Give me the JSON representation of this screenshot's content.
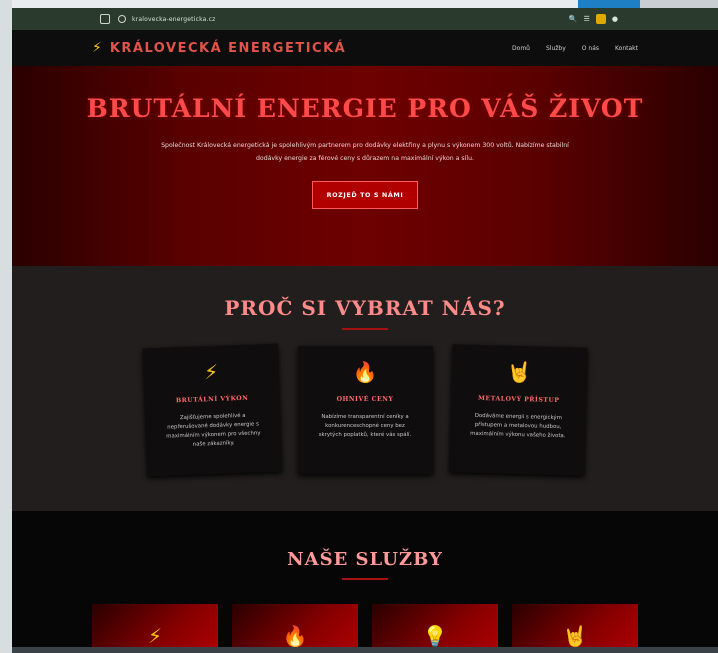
{
  "browser": {
    "url": "kralovecka-energeticka.cz",
    "right_icons": [
      "zoom-icon",
      "menu-icon",
      "extension-icon",
      "profile-icon"
    ]
  },
  "nav": {
    "logo_icon": "lightning-icon",
    "logo_text": "KRÁLOVECKÁ ENERGETICKÁ",
    "links": [
      "Domů",
      "Služby",
      "O nás",
      "Kontakt"
    ]
  },
  "hero": {
    "title": "BRUTÁLNÍ ENERGIE PRO VÁŠ ŽIVOT",
    "text": "Společnost Královecká energetická je spolehlivým partnerem pro dodávky elektřiny a plynu s výkonem 300 voltů. Nabízíme stabilní dodávky energie za férové ceny s důrazem na maximální výkon a sílu.",
    "button": "ROZJEĎ TO S NÁMI"
  },
  "why": {
    "title": "PROČ SI VYBRAT NÁS?",
    "cards": [
      {
        "icon": "lightning-icon",
        "glyph": "⚡",
        "title": "BRUTÁLNÍ VÝKON",
        "text": "Zajišťujeme spolehlivé a nepřerušované dodávky energie s maximálním výkonem pro všechny naše zákazníky."
      },
      {
        "icon": "fire-icon",
        "glyph": "🔥",
        "title": "OHNIVÉ CENY",
        "text": "Nabízíme transparentní ceníky a konkurenceschopné ceny bez skrytých poplatků, které vás spálí."
      },
      {
        "icon": "rock-hand-icon",
        "glyph": "🤘",
        "title": "METALOVÝ PŘÍSTUP",
        "text": "Dodáváme energii s energickým přístupem a metalovou hudbou, maximálním výkonu vašeho života."
      }
    ]
  },
  "services": {
    "title": "NAŠE SLUŽBY",
    "items": [
      {
        "icon": "lightning-icon",
        "glyph": "⚡"
      },
      {
        "icon": "fire-icon",
        "glyph": "🔥"
      },
      {
        "icon": "lightbulb-icon",
        "glyph": "💡"
      },
      {
        "icon": "rock-hand-icon",
        "glyph": "🤘"
      }
    ]
  },
  "colors": {
    "accent": "#b10000",
    "title_red": "#ff4a4a",
    "hero_bg": "#5a0000",
    "section_dark": "#221e1e"
  }
}
